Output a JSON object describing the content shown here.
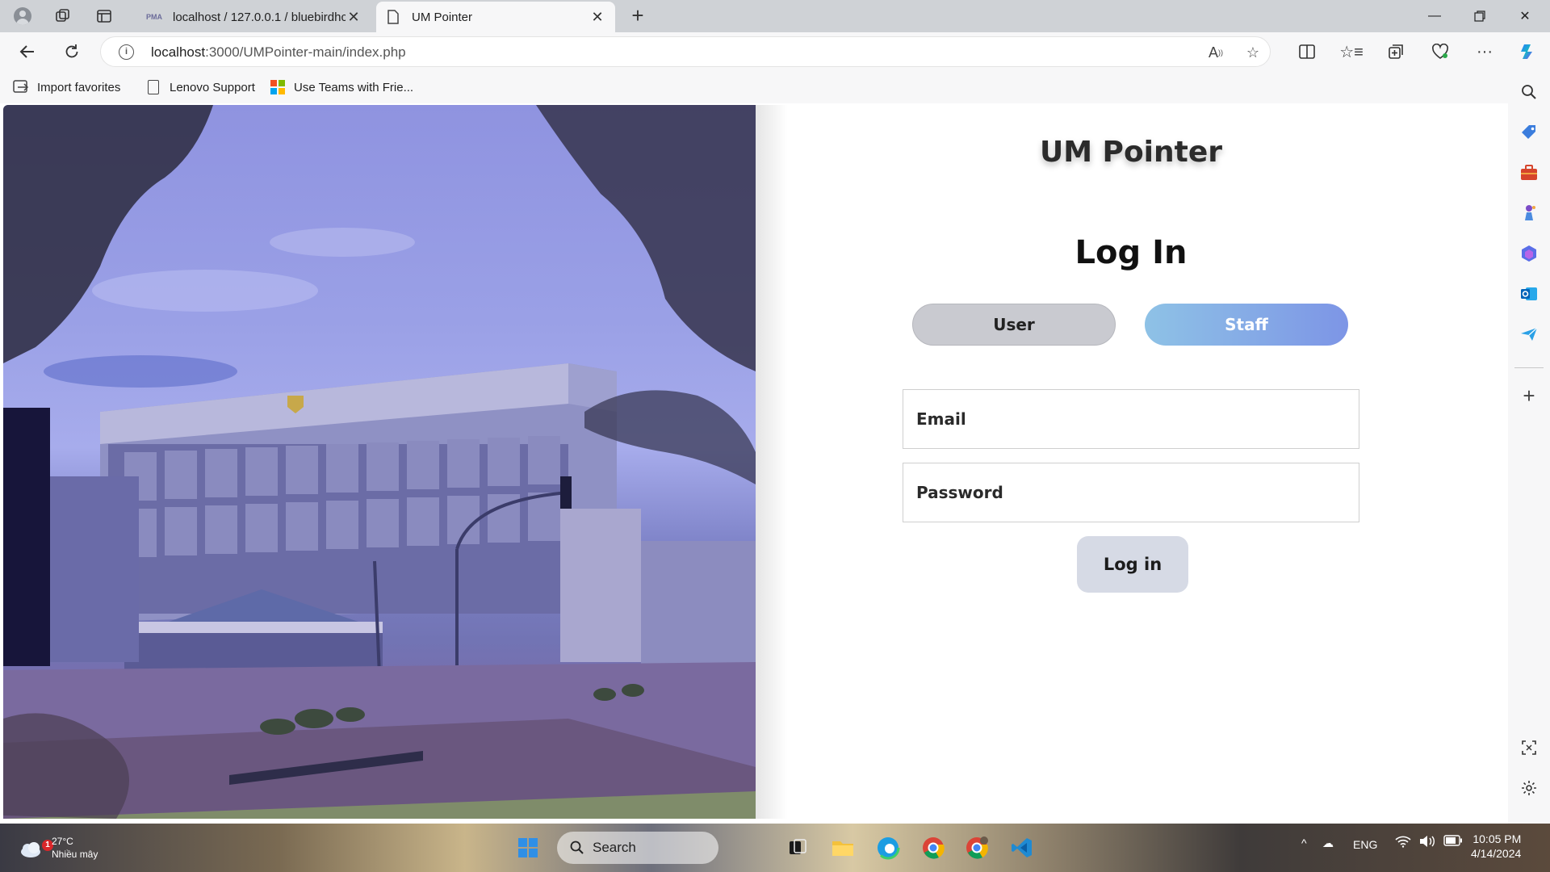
{
  "browser": {
    "tabs": [
      {
        "title": "localhost / 127.0.0.1 / bluebirdhc",
        "favicon": "phpmyadmin-icon",
        "active": false
      },
      {
        "title": "UM Pointer",
        "favicon": "page-icon",
        "active": true
      }
    ],
    "new_tab": "+",
    "address": {
      "host": "localhost",
      "path": ":3000/UMPointer-main/index.php"
    },
    "favorites": [
      {
        "label": "Import favorites",
        "icon": "import-icon"
      },
      {
        "label": "Lenovo Support",
        "icon": "page-icon"
      },
      {
        "label": "Use Teams with Frie...",
        "icon": "microsoft-icon"
      }
    ]
  },
  "page": {
    "brand": "UM Pointer",
    "title": "Log In",
    "roles": {
      "user": "User",
      "staff": "Staff",
      "selected": "staff"
    },
    "email_placeholder": "Email",
    "password_placeholder": "Password",
    "submit": "Log in"
  },
  "taskbar": {
    "weather_temp": "27°C",
    "weather_desc": "Nhiều mây",
    "notification_count": "1",
    "search": "Search",
    "language": "ENG",
    "time": "10:05 PM",
    "date": "4/14/2024"
  },
  "colors": {
    "staff_gradient_start": "#8ec2e6",
    "staff_gradient_end": "#7d95e6",
    "user_button": "#c9cad0",
    "login_button": "#d6dae5",
    "photo_tint": "#9aa0e6"
  }
}
